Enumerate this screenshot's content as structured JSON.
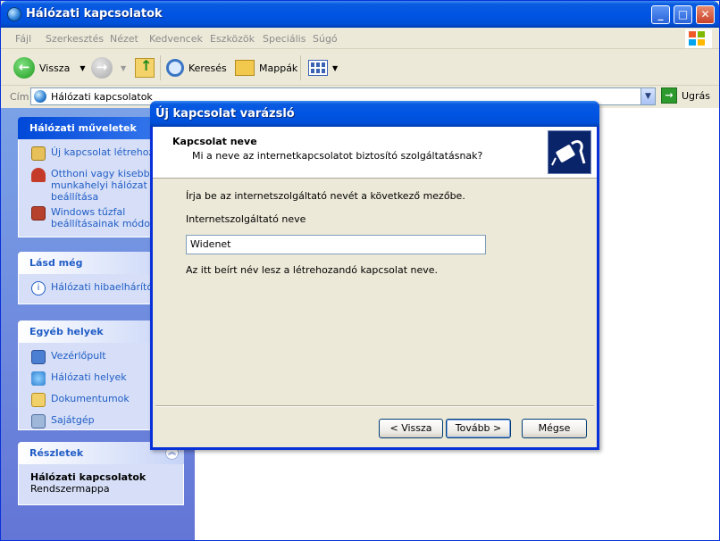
{
  "window": {
    "title": "Hálózati kapcsolatok"
  },
  "menu": [
    "Fájl",
    "Szerkesztés",
    "Nézet",
    "Kedvencek",
    "Eszközök",
    "Speciális",
    "Súgó"
  ],
  "toolbar": {
    "back_label": "Vissza",
    "search_label": "Keresés",
    "folders_label": "Mappák"
  },
  "address": {
    "label": "Cím",
    "value": "Hálózati kapcsolatok",
    "go_label": "Ugrás"
  },
  "taskpane": {
    "network_tasks": {
      "title": "Hálózati műveletek",
      "items": [
        "Új kapcsolat létrehozása",
        "Otthoni vagy kisebb munkahelyi hálózat beállítása",
        "Windows tűzfal beállításainak módosítása"
      ]
    },
    "see_also": {
      "title": "Lásd még",
      "items": [
        "Hálózati hibaelhárító"
      ]
    },
    "other_places": {
      "title": "Egyéb helyek",
      "items": [
        "Vezérlőpult",
        "Hálózati helyek",
        "Dokumentumok",
        "Sajátgép"
      ]
    },
    "details": {
      "title": "Részletek",
      "name": "Hálózati kapcsolatok",
      "type": "Rendszermappa"
    }
  },
  "wizard": {
    "title": "Új kapcsolat varázsló",
    "heading": "Kapcsolat neve",
    "subheading": "Mi a neve az internetkapcsolatot biztosító szolgáltatásnak?",
    "instruction": "Írja be az internetszolgáltató nevét a következő mezőbe.",
    "field_label": "Internetszolgáltató neve",
    "field_value": "Widenet",
    "note": "Az itt beírt név lesz a létrehozandó kapcsolat neve.",
    "buttons": {
      "back": "< Vissza",
      "next": "Tovább >",
      "cancel": "Mégse"
    }
  }
}
